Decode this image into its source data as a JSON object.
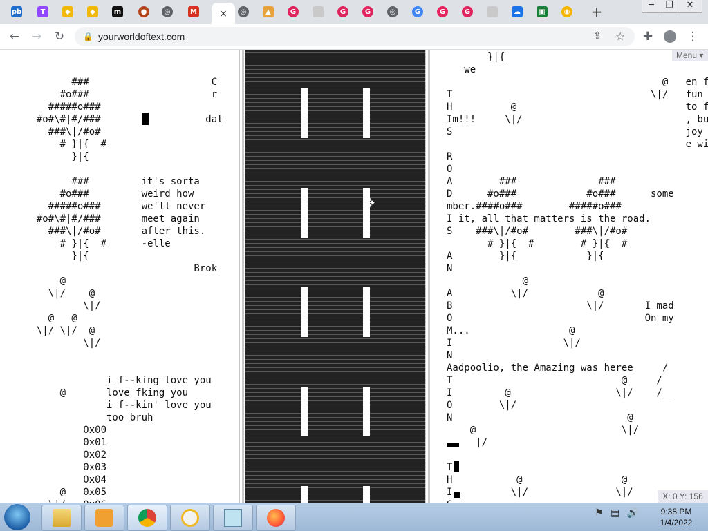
{
  "browser": {
    "tabs": [
      {
        "label": "pb",
        "bg": "#1f6fd1"
      },
      {
        "label": "T",
        "bg": "#9146ff"
      },
      {
        "label": "◆",
        "bg": "#f0b90b"
      },
      {
        "label": "◆",
        "bg": "#f0b90b"
      },
      {
        "label": "m",
        "bg": "#111111"
      },
      {
        "label": "●",
        "bg": "#b5451b"
      },
      {
        "label": "◎",
        "bg": "#5f6368"
      },
      {
        "label": "M",
        "bg": "#d93025"
      },
      {
        "label": "×",
        "bg": "#ffffff"
      },
      {
        "label": "◎",
        "bg": "#5f6368"
      },
      {
        "label": "▲",
        "bg": "#e8a33d"
      },
      {
        "label": "G",
        "bg": "#e0245e"
      },
      {
        "label": "",
        "bg": "#c9c9c9"
      },
      {
        "label": "G",
        "bg": "#e0245e"
      },
      {
        "label": "G",
        "bg": "#e0245e"
      },
      {
        "label": "◎",
        "bg": "#5f6368"
      },
      {
        "label": "G",
        "bg": "#4285f4"
      },
      {
        "label": "G",
        "bg": "#e0245e"
      },
      {
        "label": "G",
        "bg": "#e0245e"
      },
      {
        "label": "",
        "bg": "#c9c9c9"
      },
      {
        "label": "☁",
        "bg": "#1a73e8"
      },
      {
        "label": "▣",
        "bg": "#188038"
      },
      {
        "label": "◉",
        "bg": "#f4b400"
      }
    ],
    "new_tab_label": "+",
    "window_controls": {
      "minimize": "─",
      "restore": "❐",
      "close": "✕"
    },
    "url": "yourworldoftext.com",
    "lock_icon": "🔒"
  },
  "page": {
    "menu_label": "Menu ▾",
    "coords_readout": "X: 0 Y: 156",
    "left_art_a": "        ###                     C\n      #o###                     r\n    #####o###\n  #o#\\#|#/###                  dat\n    ###\\|/#o#\n      # }|{  #\n        }|{",
    "left_art_b": "        ###         it's sorta\n      #o###         weird how\n    #####o###       we'll never\n  #o#\\#|#/###       meet again\n    ###\\|/#o#       after this.\n      # }|{  #      -elle\n        }|{\n                             Brok\n      @\n    \\|/    @\n          \\|/\n    @   @\n  \\|/ \\|/  @\n          \\|/",
    "left_art_c": "              i f--king love you\n      @       love fking you\n              i f--kin' love you\n              too bruh\n          0x00\n          0x01\n          0x02\n          0x03\n          0x04\n      @   0x05\n    \\|/   0x06",
    "right_art": "       }|{\n   we\n                                     @   en fun\nT                                  \\|/   fun fo\nH          @                             to fol\nIm!!!     \\|/                            , but\nS                                        joy ev\n                                         e with\nR\nO\nA        ###              ###\nD      #o###            #o###      some\nmber.####o###        #####o###\nI it, all that matters is the road.\nS    ###\\|/#o#        ###\\|/#o#\n       # }|{  #        # }|{  #\nA        }|{            }|{\nN\n             @\nA          \\|/            @\nB                       \\|/       I mad\nO                                 On my\nM...                 @\nI                   \\|/\nN\nAadpoolio, the Amazing was heree     /\nT                             @     /\nI         @                  \\|/    /__\nO        \\|/\nN                              @\n    @                         \\|/\n     |/\n\nT\nH           @                 @\nI          \\|/               \\|/\nS"
  },
  "taskbar": {
    "clock_time": "9:38 PM",
    "clock_date": "1/4/2022"
  }
}
